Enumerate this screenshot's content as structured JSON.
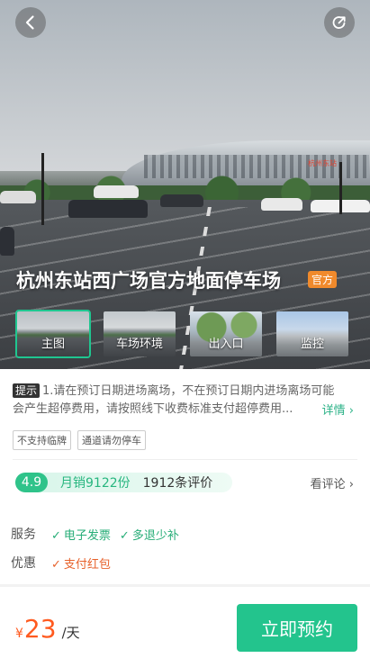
{
  "hero": {
    "title": "杭州东站西广场官方地面停车场",
    "official_badge": "官方",
    "station_sign": "杭州东站",
    "back_icon": "chevron-left-icon",
    "share_icon": "share-icon",
    "thumbnails": [
      {
        "label": "主图",
        "active": true
      },
      {
        "label": "车场环境",
        "active": false
      },
      {
        "label": "出入口",
        "active": false
      },
      {
        "label": "监控",
        "active": false
      }
    ]
  },
  "notice": {
    "tag": "提示",
    "line1": "1.请在预订日期进场离场，不在预订日期内进场离场可能",
    "line2": "会产生超停费用，请按照线下收费标准支付超停费用...",
    "detail_link": "详情 ›"
  },
  "tags": [
    "不支持临牌",
    "通道请勿停车"
  ],
  "rating": {
    "score": "4.9",
    "monthly_sales": "月销9122份",
    "review_count": "1912条评价",
    "see_reviews": "看评论 ›"
  },
  "services": {
    "service_label": "服务",
    "service_items": [
      "电子发票",
      "多退少补"
    ],
    "discount_label": "优惠",
    "discount_items": [
      "支付红包"
    ]
  },
  "bottom": {
    "currency": "¥",
    "price": "23",
    "unit": "/天",
    "book_label": "立即预约"
  },
  "colors": {
    "accent": "#23c48d",
    "price": "#ff5a1f",
    "official": "#f08a2c"
  }
}
